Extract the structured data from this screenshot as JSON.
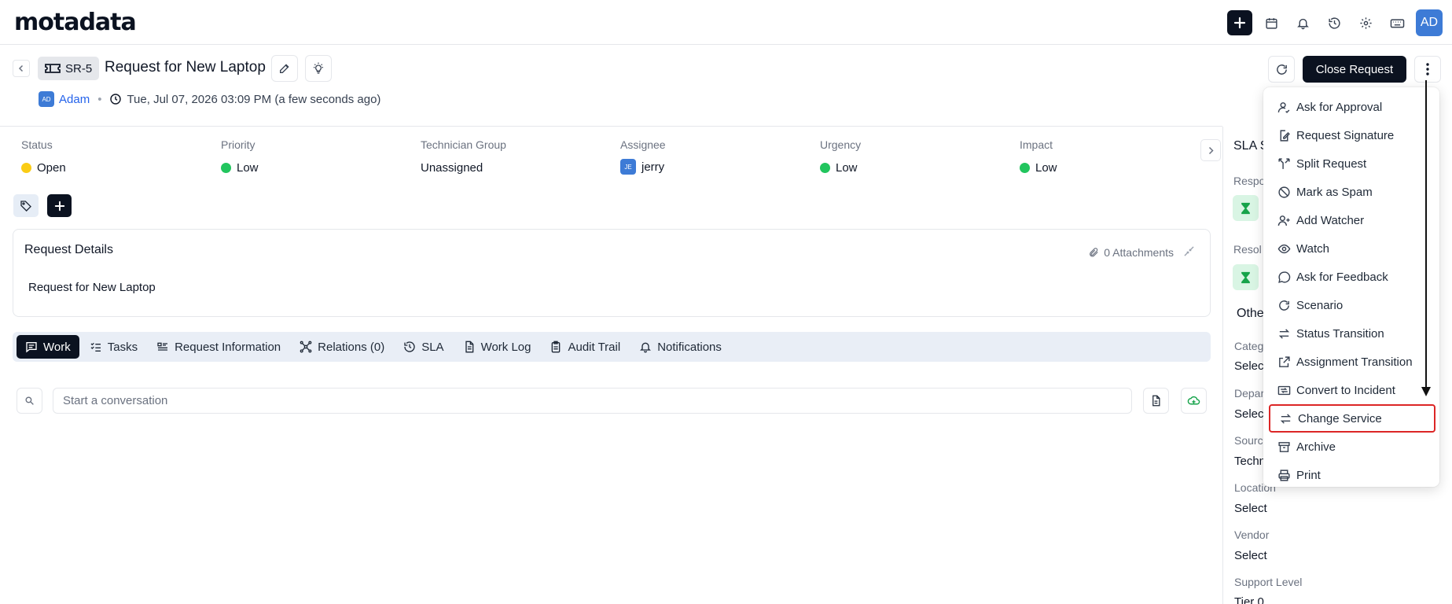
{
  "app": {
    "logo": "motadata"
  },
  "topbar": {
    "icons": [
      "plus-icon",
      "calendar-icon",
      "bell-icon",
      "history-icon",
      "gear-icon",
      "keyboard-icon"
    ],
    "avatar": "AD"
  },
  "header": {
    "ticket_id": "SR-5",
    "title": "Request for New Laptop",
    "requester_initials": "AD",
    "requester": "Adam",
    "timestamp": "Tue, Jul 07, 2026 03:09 PM (a few seconds ago)",
    "close_button": "Close Request"
  },
  "fields": {
    "status": {
      "label": "Status",
      "value": "Open",
      "color": "#facc15"
    },
    "priority": {
      "label": "Priority",
      "value": "Low",
      "color": "#22c55e"
    },
    "technician_group": {
      "label": "Technician Group",
      "value": "Unassigned"
    },
    "assignee": {
      "label": "Assignee",
      "value": "jerry",
      "initials": "JE"
    },
    "urgency": {
      "label": "Urgency",
      "value": "Low",
      "color": "#22c55e"
    },
    "impact": {
      "label": "Impact",
      "value": "Low",
      "color": "#22c55e"
    }
  },
  "details": {
    "title": "Request Details",
    "attachments": "0 Attachments",
    "body": "Request for New Laptop"
  },
  "tabs": [
    {
      "label": "Work",
      "icon": "chat-icon",
      "active": true
    },
    {
      "label": "Tasks",
      "icon": "checklist-icon"
    },
    {
      "label": "Request Information",
      "icon": "form-icon"
    },
    {
      "label": "Relations (0)",
      "icon": "relations-icon"
    },
    {
      "label": "SLA",
      "icon": "history-icon"
    },
    {
      "label": "Work Log",
      "icon": "document-icon"
    },
    {
      "label": "Audit Trail",
      "icon": "clipboard-icon"
    },
    {
      "label": "Notifications",
      "icon": "bell-icon"
    }
  ],
  "conversation": {
    "placeholder": "Start a conversation"
  },
  "side_panel": {
    "sla_title": "SLA S",
    "response_label": "Respo",
    "resolution_label": "Resol",
    "others_title": "Othe",
    "category_label": "Categ",
    "category_value": "Select",
    "department_label": "Depar",
    "department_value": "Select",
    "source_label": "Sourc",
    "source_value": "Techn",
    "location_label": "Location",
    "location_value": "Select",
    "vendor_label": "Vendor",
    "vendor_value": "Select",
    "support_level_label": "Support Level",
    "support_level_value": "Tier 0"
  },
  "menu": {
    "items": [
      {
        "label": "Ask for Approval",
        "icon": "user-check-icon"
      },
      {
        "label": "Request Signature",
        "icon": "signature-icon"
      },
      {
        "label": "Split Request",
        "icon": "split-icon"
      },
      {
        "label": "Mark as Spam",
        "icon": "ban-icon"
      },
      {
        "label": "Add Watcher",
        "icon": "user-plus-icon"
      },
      {
        "label": "Watch",
        "icon": "eye-icon"
      },
      {
        "label": "Ask for Feedback",
        "icon": "chat-bubble-icon"
      },
      {
        "label": "Scenario",
        "icon": "refresh-icon"
      },
      {
        "label": "Status Transition",
        "icon": "transfer-icon"
      },
      {
        "label": "Assignment Transition",
        "icon": "external-link-icon"
      },
      {
        "label": "Convert to Incident",
        "icon": "convert-icon"
      },
      {
        "label": "Change Service",
        "icon": "transfer-icon",
        "highlighted": true
      },
      {
        "label": "Archive",
        "icon": "archive-icon"
      },
      {
        "label": "Print",
        "icon": "printer-icon"
      }
    ]
  },
  "colors": {
    "primary_dark": "#0b1220",
    "accent_blue": "#3d7bd6",
    "highlight_red": "#dc2626",
    "tab_bg": "#e9eef6"
  }
}
